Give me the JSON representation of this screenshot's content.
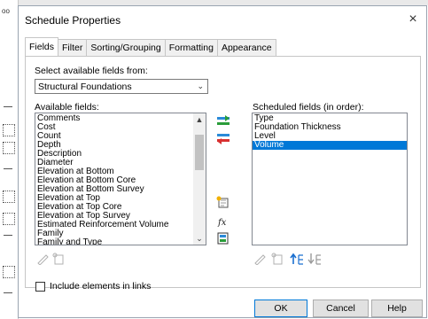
{
  "background": {
    "cad_fragment": "oo"
  },
  "dialog": {
    "title": "Schedule Properties",
    "close_glyph": "×",
    "tabs": [
      {
        "label": "Fields"
      },
      {
        "label": "Filter"
      },
      {
        "label": "Sorting/Grouping"
      },
      {
        "label": "Formatting"
      },
      {
        "label": "Appearance"
      }
    ],
    "select_label": "Select available fields from:",
    "select_value": "Structural Foundations",
    "available_label": "Available fields:",
    "available_fields": [
      "Comments",
      "Cost",
      "Count",
      "Depth",
      "Description",
      "Diameter",
      "Elevation at Bottom",
      "Elevation at Bottom Core",
      "Elevation at Bottom Survey",
      "Elevation at Top",
      "Elevation at Top Core",
      "Elevation at Top Survey",
      "Estimated Reinforcement Volume",
      "Family",
      "Family and Type"
    ],
    "scheduled_label": "Scheduled fields (in order):",
    "scheduled_fields": [
      "Type",
      "Foundation Thickness",
      "Level",
      "Volume"
    ],
    "scheduled_selected": "Volume",
    "include_links_label": "Include elements in links",
    "include_links_checked": false,
    "buttons": {
      "ok": "OK",
      "cancel": "Cancel",
      "help": "Help"
    },
    "icons": {
      "add": "add-field-icon",
      "remove": "remove-field-icon",
      "add_parameter": "add-parameter-icon",
      "calculated": "calculated-value-icon",
      "combine": "combine-parameters-icon",
      "edit": "edit-field-icon",
      "delete": "delete-field-icon",
      "move_up": "move-up-icon",
      "move_down": "move-down-icon"
    },
    "colors": {
      "accent": "#0078d7",
      "border": "#c6c6c6"
    }
  }
}
